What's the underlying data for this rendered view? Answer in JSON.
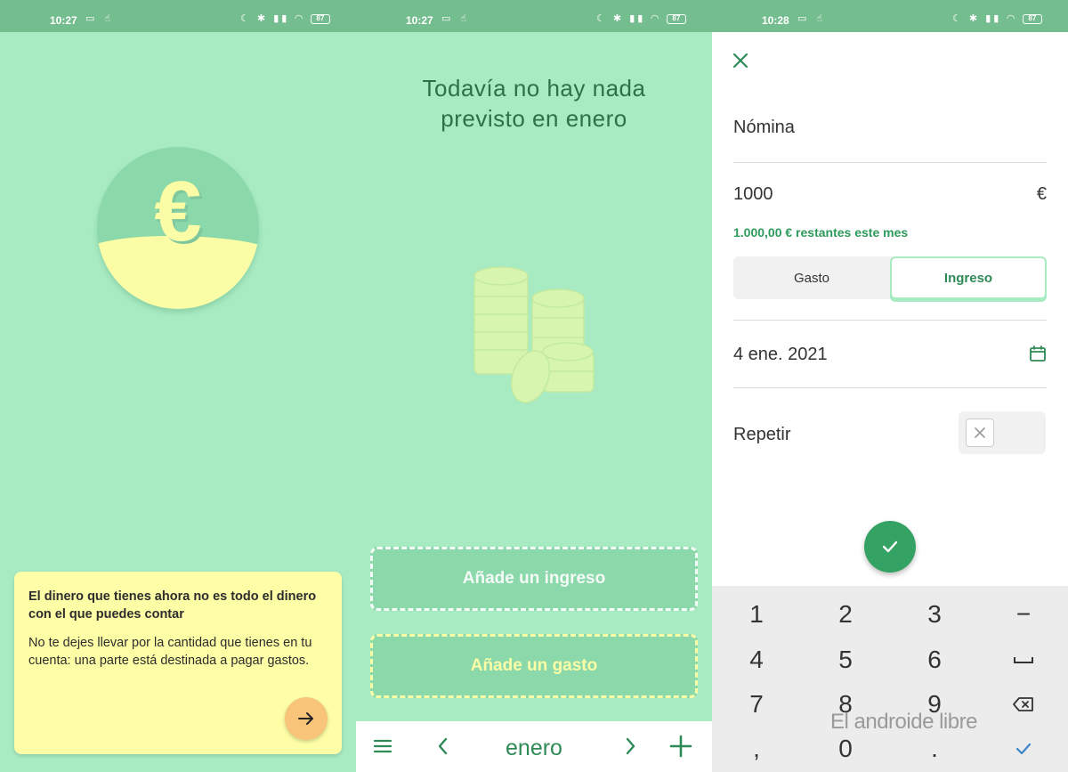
{
  "status_bars": [
    {
      "time": "10:27",
      "battery": "87"
    },
    {
      "time": "10:27",
      "battery": "87"
    },
    {
      "time": "10:28",
      "battery": "87"
    }
  ],
  "panel1": {
    "coin_symbol": "€",
    "tip_title": "El dinero que tienes ahora no es todo el dinero con el que puedes contar",
    "tip_body": "No te dejes llevar por la cantidad que tienes en tu cuenta: una parte está destinada a pagar gastos."
  },
  "panel2": {
    "empty_line1": "Todavía no hay nada",
    "empty_line2": "previsto en enero",
    "add_income": "Añade un ingreso",
    "add_expense": "Añade un gasto",
    "month": "enero"
  },
  "panel3": {
    "name": "Nómina",
    "amount": "1000",
    "currency": "€",
    "remaining": "1.000,00 € restantes este mes",
    "type_options": [
      "Gasto",
      "Ingreso"
    ],
    "selected_type": "Ingreso",
    "date": "4 ene. 2021",
    "repeat_label": "Repetir",
    "repeat_on": false,
    "keypad": [
      [
        "1",
        "2",
        "3",
        "−"
      ],
      [
        "4",
        "5",
        "6",
        "␣"
      ],
      [
        "7",
        "8",
        "9",
        "⌫"
      ],
      [
        ",",
        "0",
        ".",
        "✓"
      ]
    ],
    "watermark": "El androide libre"
  },
  "colors": {
    "mint_bg": "#a8ebc3",
    "status_bar": "#74bd8f",
    "accent_green": "#2e8a57",
    "yellow": "#fafca6",
    "orange_button": "#f8c47a",
    "fab_green": "#34a263"
  }
}
